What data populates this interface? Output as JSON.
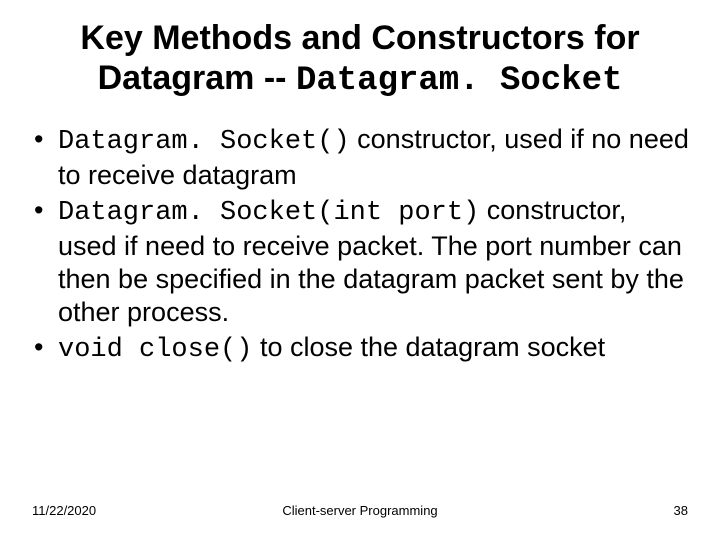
{
  "title": {
    "line1": "Key Methods and Constructors for",
    "line2_prefix": "Datagram -- ",
    "line2_mono": "Datagram. Socket"
  },
  "bullets": [
    {
      "code": "Datagram. Socket()",
      "after": " constructor, used if no need to receive datagram"
    },
    {
      "code": "Datagram. Socket(int port)",
      "after": " constructor, used if need to receive packet. The port number can then be specified in the datagram packet sent by the other process."
    },
    {
      "code": "void close()",
      "after": " to close the datagram socket"
    }
  ],
  "footer": {
    "date": "11/22/2020",
    "subject": "Client-server Programming",
    "page": "38"
  }
}
